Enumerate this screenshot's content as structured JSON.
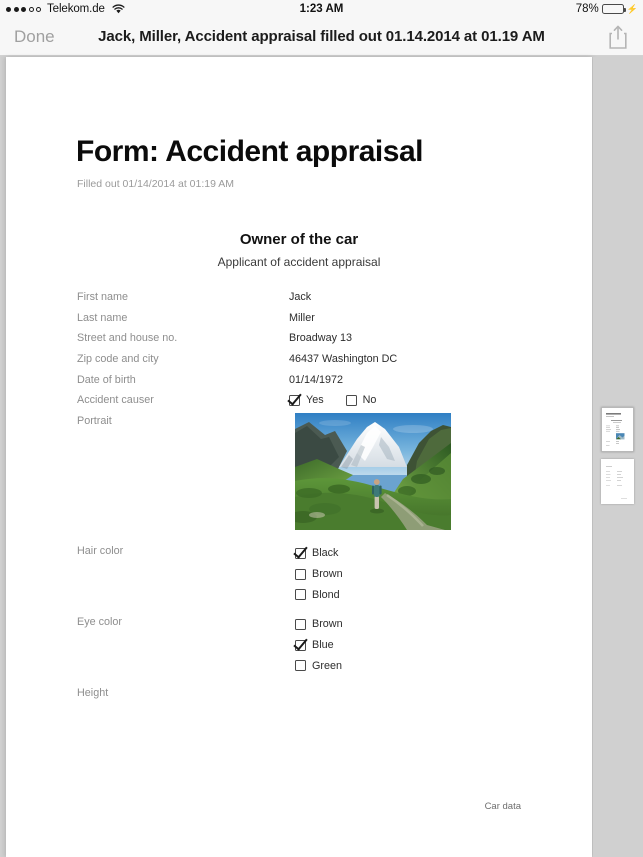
{
  "status_bar": {
    "carrier": "Telekom.de",
    "signal_filled": 3,
    "signal_total": 5,
    "wifi_icon": "wifi-icon",
    "time": "1:23 AM",
    "battery_percent": "78%",
    "battery_level": 78,
    "charging": true,
    "battery_color": "#4cd445"
  },
  "nav_bar": {
    "done_label": "Done",
    "title": "Jack, Miller, Accident appraisal filled out 01.14.2014 at 01.19 AM",
    "share_icon": "share-icon"
  },
  "document": {
    "title": "Form: Accident appraisal",
    "subtitle": "Filled out 01/14/2014 at 01:19 AM",
    "section_title": "Owner of the car",
    "section_subtitle": "Applicant of accident appraisal",
    "fields": [
      {
        "label": "First name",
        "value": "Jack"
      },
      {
        "label": "Last name",
        "value": "Miller"
      },
      {
        "label": "Street and house no.",
        "value": "Broadway 13"
      },
      {
        "label": "Zip code and city",
        "value": "46437 Washington DC"
      },
      {
        "label": "Date of birth",
        "value": "01/14/1972"
      }
    ],
    "accident_causer": {
      "label": "Accident causer",
      "options": [
        {
          "label": "Yes",
          "checked": true
        },
        {
          "label": "No",
          "checked": false
        }
      ]
    },
    "portrait": {
      "label": "Portrait",
      "image_alt": "mountain-landscape-photo"
    },
    "hair_color": {
      "label": "Hair color",
      "options": [
        {
          "label": "Black",
          "checked": true
        },
        {
          "label": "Brown",
          "checked": false
        },
        {
          "label": "Blond",
          "checked": false
        }
      ]
    },
    "eye_color": {
      "label": "Eye color",
      "options": [
        {
          "label": "Brown",
          "checked": false
        },
        {
          "label": "Blue",
          "checked": true
        },
        {
          "label": "Green",
          "checked": false
        }
      ]
    },
    "height": {
      "label": "Height",
      "value": ""
    },
    "footer_note": "Car data"
  },
  "thumbnails": {
    "pages": [
      {
        "index": 1,
        "selected": true
      },
      {
        "index": 2,
        "selected": false
      }
    ]
  }
}
